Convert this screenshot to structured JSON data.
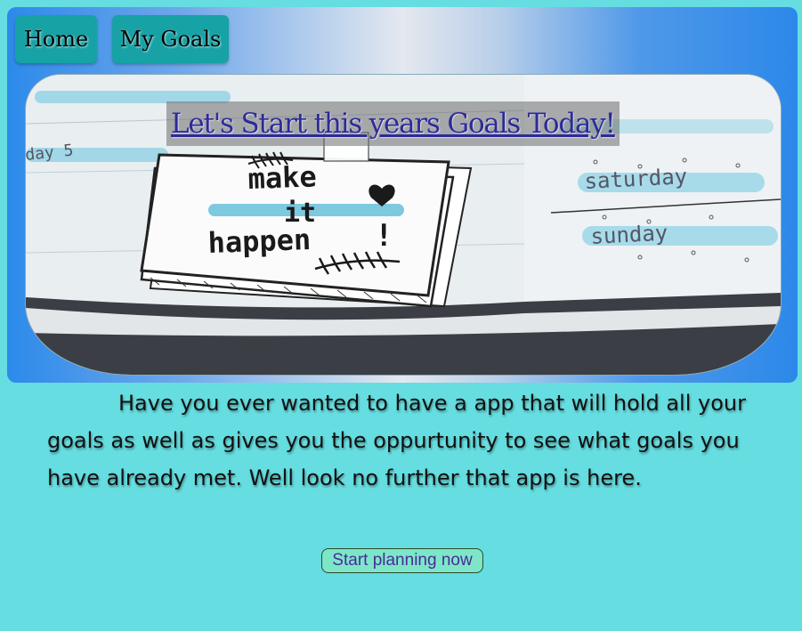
{
  "nav": {
    "home_label": "Home",
    "goals_label": "My Goals"
  },
  "hero": {
    "title": "Let's Start this years Goals Today!",
    "image": {
      "note_lines": [
        "make",
        "it",
        "happen"
      ],
      "note_exclaim": "!",
      "day_labels": [
        "saturday",
        "sunday",
        "day 5"
      ]
    }
  },
  "intro": {
    "text": "Have you ever wanted to have a app that will hold all your goals as well as gives you the oppurtunity to see what goals you have already met. Well look no further that app is here."
  },
  "cta": {
    "label": "Start planning now"
  },
  "colors": {
    "page_bg": "#66dde0",
    "nav_button": "#17a2a6",
    "header_gradient_edge": "#2c8aea",
    "title_text": "#2d2a99",
    "cta_bg": "#7ee6c8"
  }
}
